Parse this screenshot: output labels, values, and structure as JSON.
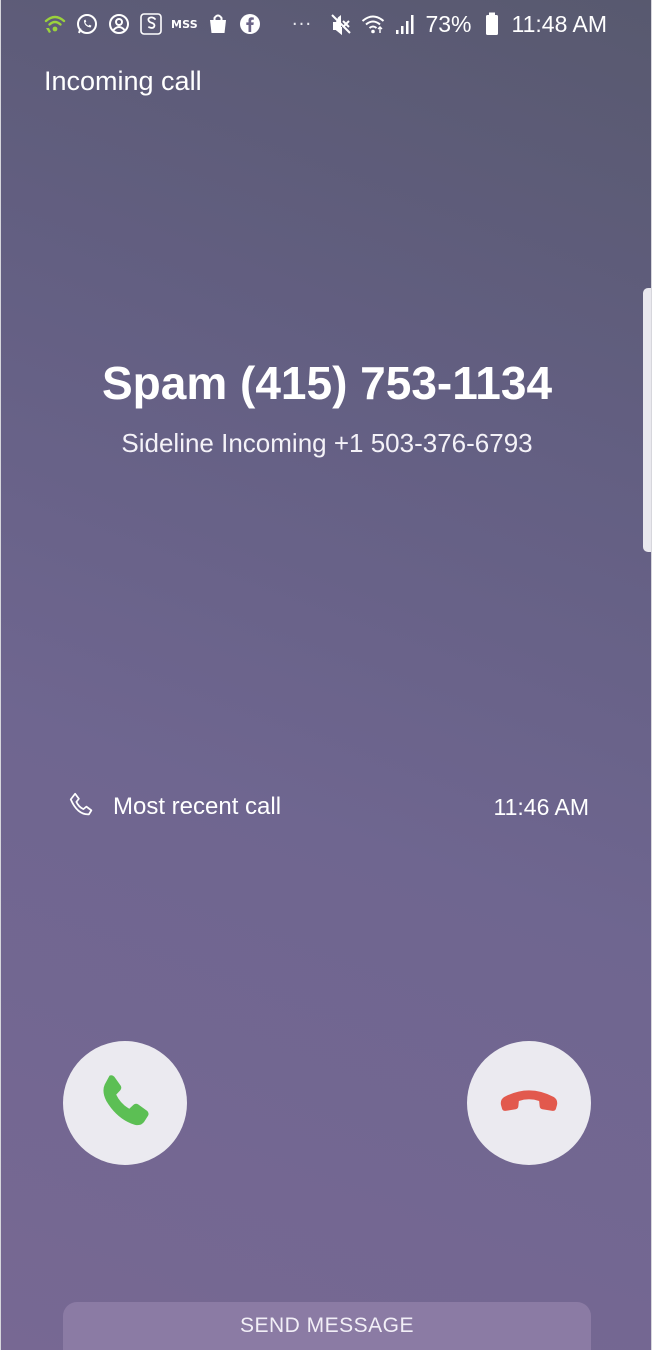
{
  "status_bar": {
    "mss_label": "MSS",
    "dots": "···",
    "battery_percent": "73%",
    "time": "11:48 AM",
    "icons": [
      "wifi-calling-icon",
      "whatsapp-icon",
      "account-icon",
      "sideline-icon",
      "shopping-bag-icon",
      "facebook-icon",
      "mute-icon",
      "wifi-icon",
      "signal-icon",
      "battery-icon"
    ],
    "wifi_calling_color": "#9bd23c"
  },
  "screen": {
    "title": "Incoming call"
  },
  "caller": {
    "name": "Spam (415) 753-1134",
    "line": "Sideline Incoming +1 503-376-6793"
  },
  "recent_call": {
    "label": "Most recent call",
    "time": "11:46 AM",
    "icon": "phone-outline-icon"
  },
  "actions": {
    "accept_icon": "phone-accept-icon",
    "accept_color": "#5cbf54",
    "decline_icon": "phone-decline-icon",
    "decline_color": "#e2594d",
    "send_message_label": "SEND MESSAGE"
  }
}
